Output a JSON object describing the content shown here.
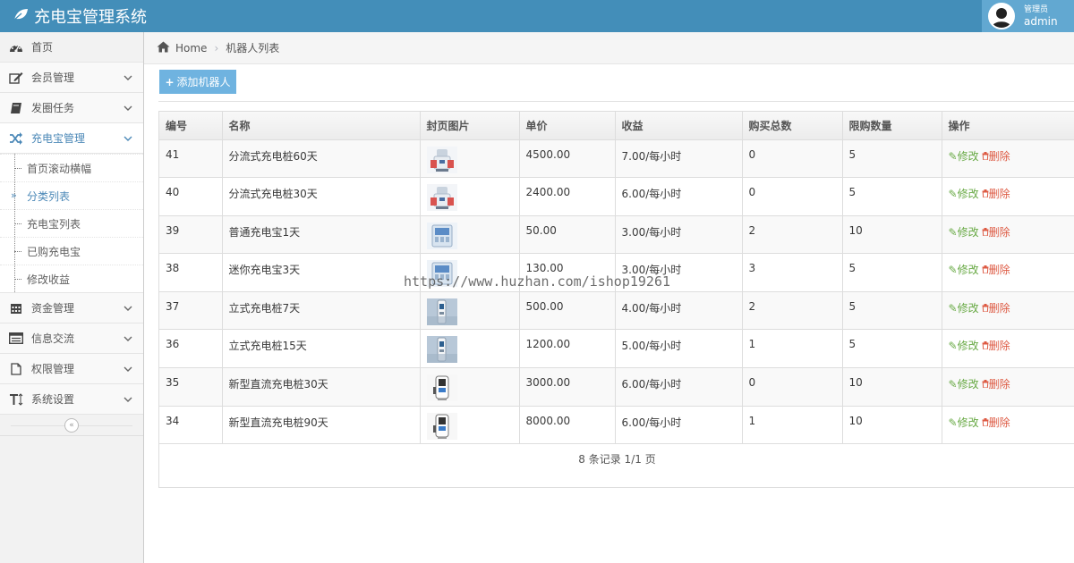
{
  "app": {
    "title": "充电宝管理系统",
    "colors": {
      "navbar": "#438eb9",
      "user_box": "#62a8d1",
      "accent": "#6fb3e0",
      "edit": "#69aa46",
      "delete": "#dd5a43"
    }
  },
  "user": {
    "role": "管理员",
    "name": "admin"
  },
  "sidebar": {
    "items": [
      {
        "label": "首页",
        "icon": "dashboard-icon"
      },
      {
        "label": "会员管理",
        "icon": "edit-icon"
      },
      {
        "label": "发圈任务",
        "icon": "book-icon"
      },
      {
        "label": "充电宝管理",
        "icon": "shuffle-icon"
      },
      {
        "label": "资金管理",
        "icon": "calendar-icon"
      },
      {
        "label": "信息交流",
        "icon": "list-alt-icon"
      },
      {
        "label": "权限管理",
        "icon": "file-icon"
      },
      {
        "label": "系统设置",
        "icon": "text-height-icon"
      }
    ],
    "submenu": [
      {
        "label": "首页滚动横幅"
      },
      {
        "label": "分类列表"
      },
      {
        "label": "充电宝列表"
      },
      {
        "label": "已购充电宝"
      },
      {
        "label": "修改收益"
      }
    ]
  },
  "breadcrumb": {
    "home": "Home",
    "current": "机器人列表"
  },
  "toolbar": {
    "add_label": "添加机器人"
  },
  "table": {
    "headers": [
      "编号",
      "名称",
      "封页图片",
      "单价",
      "收益",
      "购买总数",
      "限购数量",
      "操作"
    ],
    "edit_label": "修改",
    "delete_label": "删除",
    "rows": [
      {
        "id": "41",
        "name": "分流式充电桩60天",
        "image": "robot-charger-thumb",
        "price": "4500.00",
        "income": "7.00/每小时",
        "total": "0",
        "limit": "5"
      },
      {
        "id": "40",
        "name": "分流式充电桩30天",
        "image": "robot-charger-thumb",
        "price": "2400.00",
        "income": "6.00/每小时",
        "total": "0",
        "limit": "5"
      },
      {
        "id": "39",
        "name": "普通充电宝1天",
        "image": "machine-thumb",
        "price": "50.00",
        "income": "3.00/每小时",
        "total": "2",
        "limit": "10"
      },
      {
        "id": "38",
        "name": "迷你充电宝3天",
        "image": "machine-thumb",
        "price": "130.00",
        "income": "3.00/每小时",
        "total": "3",
        "limit": "5"
      },
      {
        "id": "37",
        "name": "立式充电桩7天",
        "image": "pillar-charger-thumb",
        "price": "500.00",
        "income": "4.00/每小时",
        "total": "2",
        "limit": "5"
      },
      {
        "id": "36",
        "name": "立式充电桩15天",
        "image": "pillar-charger-thumb",
        "price": "1200.00",
        "income": "5.00/每小时",
        "total": "1",
        "limit": "5"
      },
      {
        "id": "35",
        "name": "新型直流充电桩30天",
        "image": "dc-charger-thumb",
        "price": "3000.00",
        "income": "6.00/每小时",
        "total": "0",
        "limit": "10"
      },
      {
        "id": "34",
        "name": "新型直流充电桩90天",
        "image": "dc-charger-thumb",
        "price": "8000.00",
        "income": "6.00/每小时",
        "total": "1",
        "limit": "10"
      }
    ]
  },
  "pager": {
    "text": "8 条记录 1/1 页"
  },
  "watermark": "https://www.huzhan.com/ishop19261"
}
